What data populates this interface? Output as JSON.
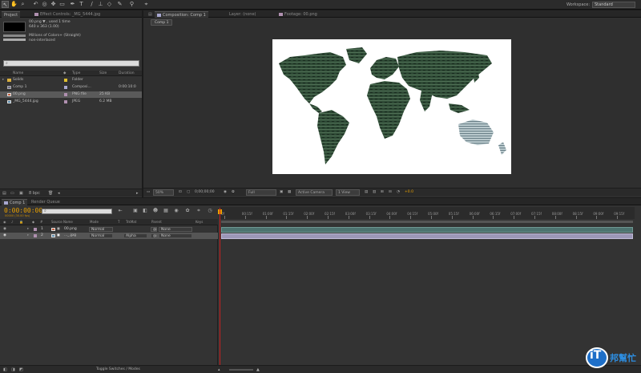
{
  "toolbar": {
    "tools": [
      "selection-tool",
      "hand-tool",
      "zoom-tool",
      "rotate-tool",
      "camera-orbit-tool",
      "pan-behind-tool",
      "pen-tool",
      "text-tool",
      "brush-tool",
      "clone-stamp-tool",
      "eraser-tool",
      "roto-brush-tool",
      "puppet-pin-tool"
    ],
    "workspace_label": "Workspace:",
    "workspace_value": "Standard"
  },
  "project_panel": {
    "tab_project": "Project",
    "tab_effect_controls": "Effect Controls: _MG_5444.jpg",
    "selected_info": {
      "name_line": "00.png ▼ , used 1 time",
      "dims_line": "640 x 363 (1.00)",
      "color_line": "Millions of Colors+ (Straight)",
      "interlace_line": "non-interlaced"
    },
    "search_placeholder": "",
    "columns": {
      "name": "Name",
      "type": "Type",
      "size": "Size",
      "duration": "Duration"
    },
    "items": [
      {
        "name": "Solids",
        "type": "Folder",
        "size": "",
        "duration": "",
        "label_color": "#e0c030",
        "icon": "folder-icon"
      },
      {
        "name": "Comp 1",
        "type": "Composi...",
        "size": "",
        "duration": "0:00:10:0",
        "label_color": "#a8a8d0",
        "icon": "composition-icon"
      },
      {
        "name": "00.png",
        "type": "PNG file",
        "size": "25 KB",
        "duration": "",
        "label_color": "#b090b0",
        "icon": "image-icon",
        "selected": true
      },
      {
        "name": "_MG_5444.jpg",
        "type": "JPEG",
        "size": "6.2 MB",
        "duration": "",
        "label_color": "#b090b0",
        "icon": "image-icon"
      }
    ],
    "bottom": {
      "bpc": "8 bpc"
    }
  },
  "viewer": {
    "tab_composition": "Composition: Comp 1",
    "tab_layer": "Layer: (none)",
    "tab_footage": "Footage: 00.png",
    "comp_subtab": "Comp 1",
    "zoom": "50%",
    "timecode": "0;00;00;00",
    "resolution": "Full",
    "camera": "Active Camera",
    "view_count": "1 View",
    "exposure": "+0.0"
  },
  "timeline": {
    "tab_comp": "Comp 1",
    "tab_render": "Render Queue",
    "current_time": "0:00:00:00",
    "fps": "00000 (30.00 fps)",
    "columns": {
      "source_name": "Source Name",
      "mode": "Mode",
      "t": "T",
      "trkmat": "TrkMat",
      "parent": "Parent",
      "keys": "Keys"
    },
    "layers": [
      {
        "num": "1",
        "name": "00.png",
        "mode": "Normal",
        "trkmat": "",
        "parent": "None",
        "label_color": "#b090b0"
      },
      {
        "num": "2",
        "name": "..._.jpg",
        "mode": "Normal",
        "trkmat": "Alpha",
        "parent": "None",
        "label_color": "#b090b0",
        "selected": true
      }
    ],
    "ruler_ticks": [
      "0f",
      "00:15f",
      "01:00f",
      "01:15f",
      "02:00f",
      "02:15f",
      "03:00f",
      "03:15f",
      "04:00f",
      "04:15f",
      "05:00f",
      "05:15f",
      "06:00f",
      "06:15f",
      "07:00f",
      "07:15f",
      "08:00f",
      "08:15f",
      "09:00f",
      "09:15f"
    ],
    "toggle_label": "Toggle Switches / Modes"
  },
  "watermark": {
    "text_main": "iT",
    "text_sub": "邦幫忙"
  }
}
